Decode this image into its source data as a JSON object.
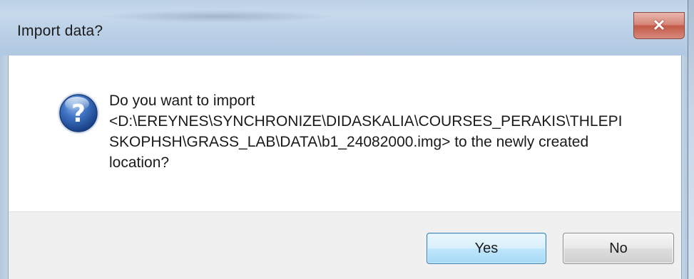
{
  "dialog": {
    "title": "Import data?",
    "close_icon": "close-icon",
    "message_icon": "question-icon",
    "message_lines": [
      "Do you want to import",
      "<D:\\EREYNES\\SYNCHRONIZE\\DIDASKALIA\\COURSES_PERAKIS\\THLEPI",
      "SKOPHSH\\GRASS_LAB\\DATA\\b1_24082000.img> to the newly created",
      "location?"
    ],
    "buttons": {
      "yes_label": "Yes",
      "no_label": "No"
    }
  },
  "colors": {
    "titlebar": "#bcd0e6",
    "close_button": "#c45a49",
    "default_button_border": "#3c7fb1",
    "icon_blue": "#2f5fa8"
  }
}
